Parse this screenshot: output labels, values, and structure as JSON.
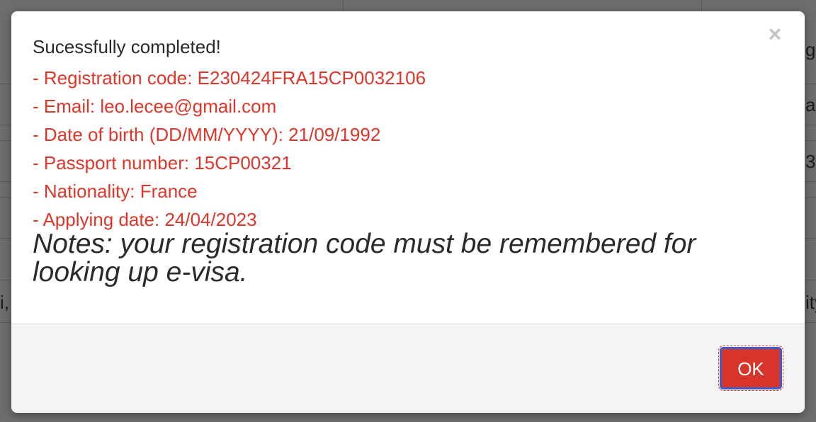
{
  "background": {
    "right_fragments": [
      "g",
      "a",
      "3",
      "ity"
    ],
    "left_fragments": [
      "i,"
    ]
  },
  "modal": {
    "close_symbol": "×",
    "title": "Sucessfully completed!",
    "details": [
      "- Registration code: E230424FRA15CP0032106",
      "- Email: leo.lecee@gmail.com",
      "- Date of birth (DD/MM/YYYY): 21/09/1992",
      "- Passport number: 15CP00321",
      "- Nationality: France",
      "- Applying date: 24/04/2023"
    ],
    "note": "Notes: your registration code must be remembered for looking up e-visa.",
    "ok_label": "OK"
  },
  "colors": {
    "detail_text": "#e0362a",
    "ok_button": "#d9342b",
    "ok_focus_border": "#3a5ec9",
    "footer_bg": "#f4f4f4",
    "overlay": "#6d6d6d"
  }
}
